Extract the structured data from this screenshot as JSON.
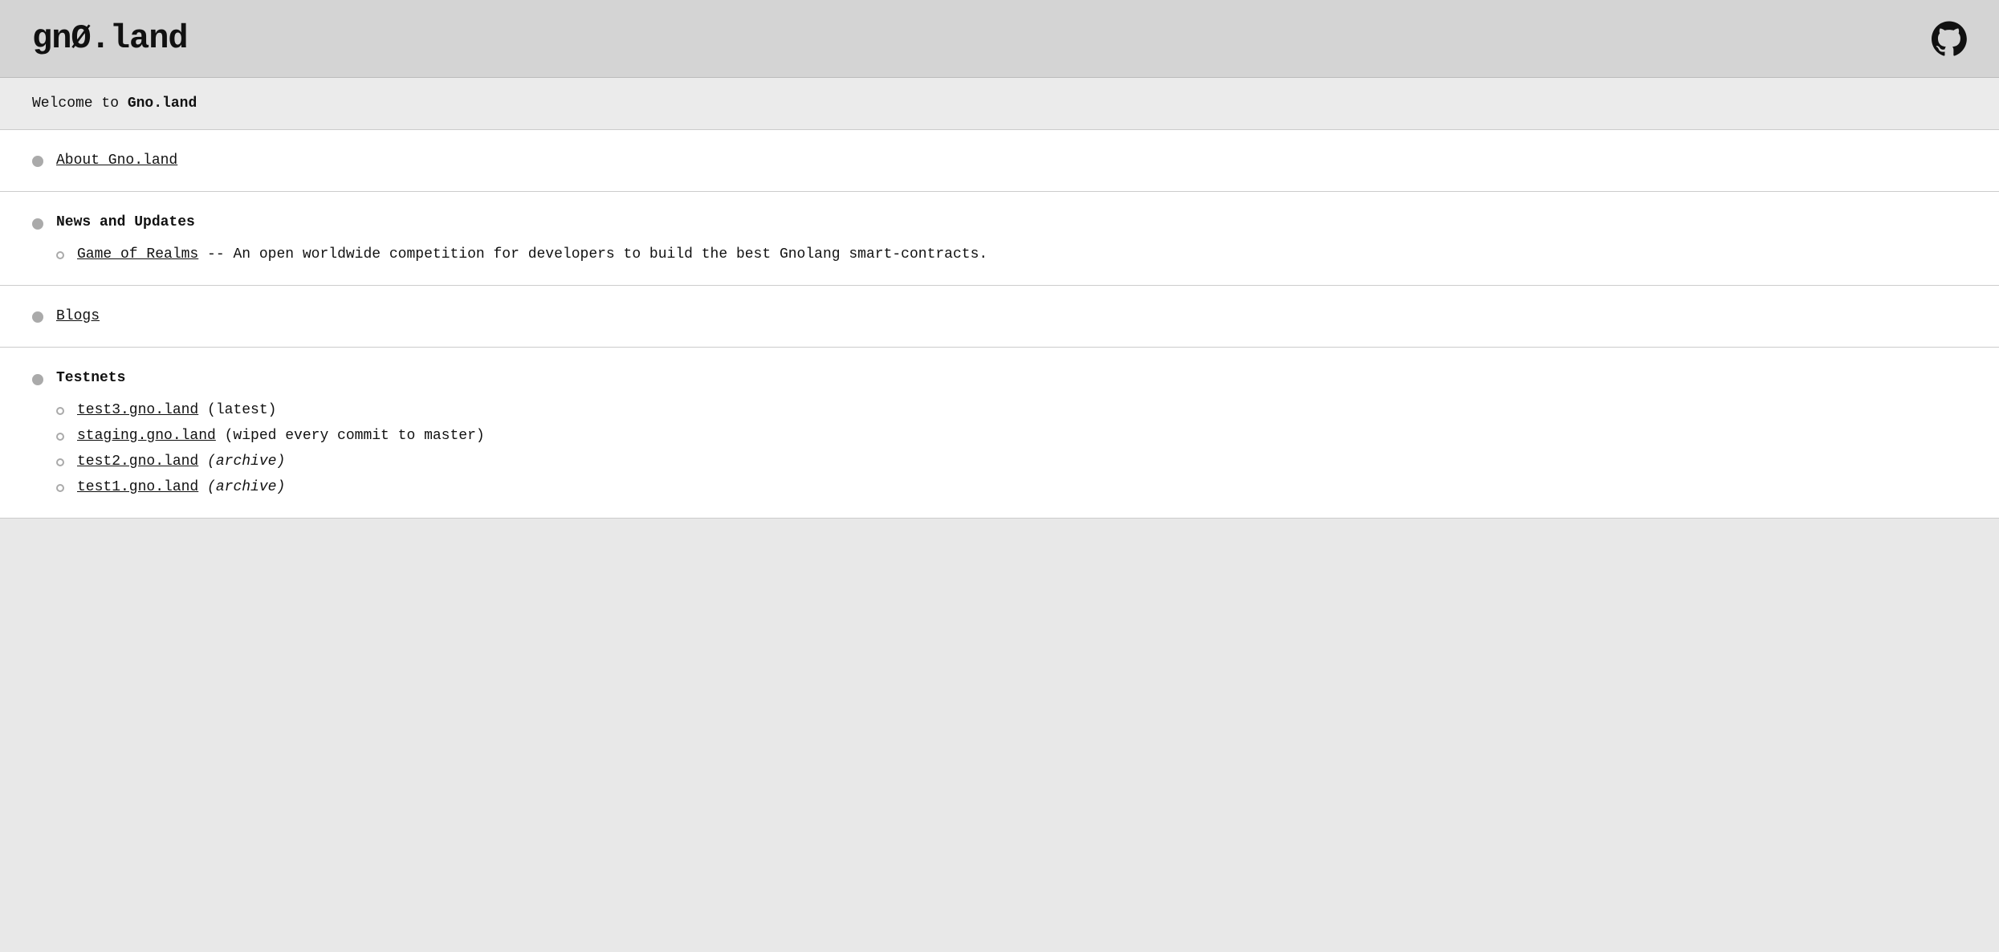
{
  "header": {
    "logo": "gnØ.land",
    "github_icon_label": "GitHub"
  },
  "welcome": {
    "prefix": "Welcome to ",
    "site_name": "Gno.land"
  },
  "about": {
    "link_text": "About Gno.land"
  },
  "news": {
    "title": "News and Updates",
    "items": [
      {
        "link": "Game of Realms",
        "description": " -- An open worldwide competition for developers to build the best Gnolang smart-contracts."
      }
    ]
  },
  "blogs": {
    "link_text": "Blogs"
  },
  "testnets": {
    "title": "Testnets",
    "items": [
      {
        "link": "test3.gno.land",
        "suffix": " (latest)",
        "italic": false
      },
      {
        "link": "staging.gno.land",
        "suffix": " (wiped every commit to master)",
        "italic": false
      },
      {
        "link": "test2.gno.land",
        "suffix": " (archive)",
        "italic": true
      },
      {
        "link": "test1.gno.land",
        "suffix": " (archive)",
        "italic": true
      }
    ]
  }
}
